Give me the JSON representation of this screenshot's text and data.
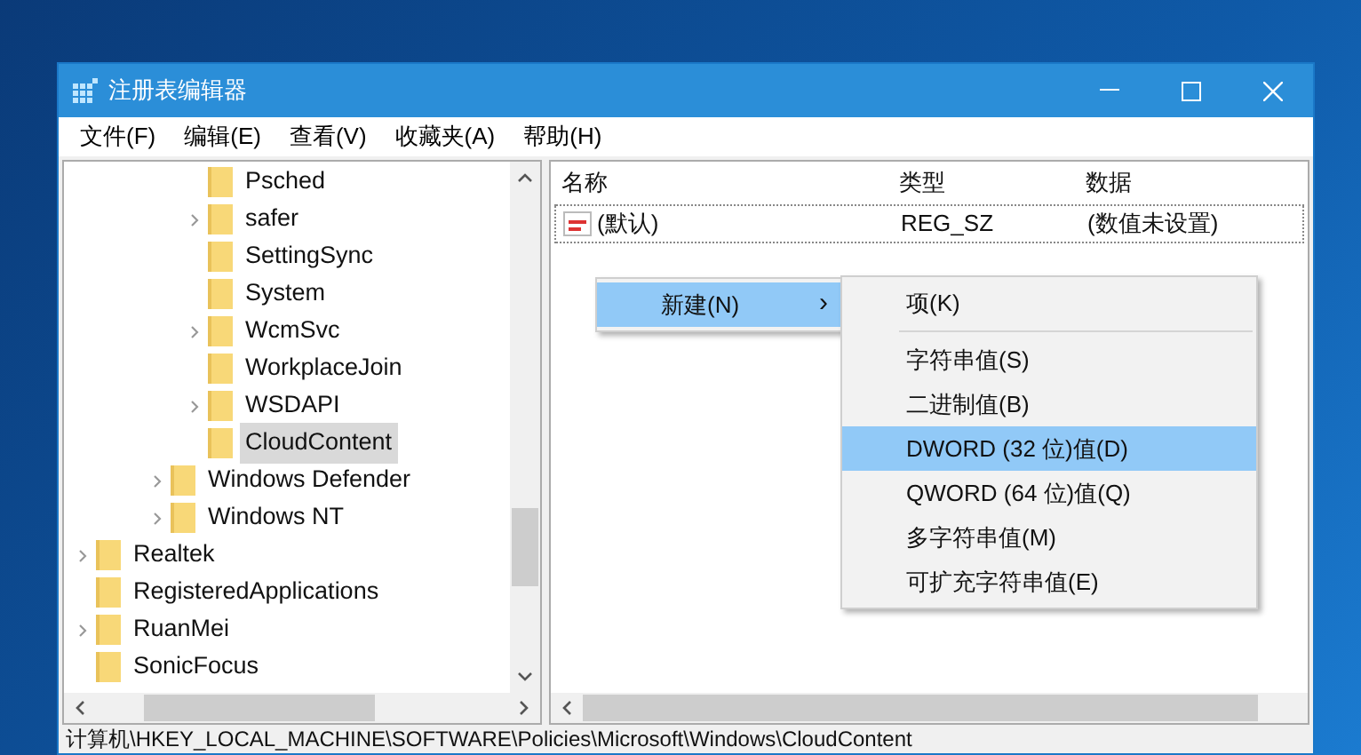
{
  "window": {
    "title": "注册表编辑器"
  },
  "menu_bar": [
    "文件(F)",
    "编辑(E)",
    "查看(V)",
    "收藏夹(A)",
    "帮助(H)"
  ],
  "tree": [
    {
      "children": [
        {
          "children": [
            {
              "children": [
                {
                  "label": "Psched",
                  "expandable": false,
                  "selected": false
                },
                {
                  "label": "safer",
                  "expandable": true,
                  "selected": false
                },
                {
                  "label": "SettingSync",
                  "expandable": false,
                  "selected": false
                },
                {
                  "label": "System",
                  "expandable": false,
                  "selected": false
                },
                {
                  "label": "WcmSvc",
                  "expandable": true,
                  "selected": false
                },
                {
                  "label": "WorkplaceJoin",
                  "expandable": false,
                  "selected": false
                },
                {
                  "label": "WSDAPI",
                  "expandable": true,
                  "selected": false
                },
                {
                  "label": "CloudContent",
                  "expandable": false,
                  "selected": true
                }
              ]
            },
            {
              "label": "Windows Defender",
              "expandable": true,
              "selected": false
            },
            {
              "label": "Windows NT",
              "expandable": true,
              "selected": false
            }
          ]
        }
      ]
    },
    {
      "label": "Realtek",
      "expandable": true,
      "selected": false
    },
    {
      "label": "RegisteredApplications",
      "expandable": false,
      "selected": false
    },
    {
      "label": "RuanMei",
      "expandable": true,
      "selected": false
    },
    {
      "label": "SonicFocus",
      "expandable": false,
      "selected": false
    }
  ],
  "values_list": {
    "columns": [
      "名称",
      "类型",
      "数据"
    ],
    "rows": [
      {
        "name": "(默认)",
        "type": "REG_SZ",
        "data": "(数值未设置)"
      }
    ]
  },
  "context_menu": {
    "items": [
      {
        "label": "新建(N)",
        "arrow": "›",
        "selected": true
      }
    ]
  },
  "submenu": {
    "items": [
      {
        "kind": "item",
        "label": "项(K)",
        "selected": false
      },
      {
        "kind": "separator"
      },
      {
        "kind": "item",
        "label": "字符串值(S)",
        "selected": false
      },
      {
        "kind": "item",
        "label": "二进制值(B)",
        "selected": false
      },
      {
        "kind": "item",
        "label": "DWORD (32 位)值(D)",
        "selected": true
      },
      {
        "kind": "item",
        "label": "QWORD (64 位)值(Q)",
        "selected": false
      },
      {
        "kind": "item",
        "label": "多字符串值(M)",
        "selected": false
      },
      {
        "kind": "item",
        "label": "可扩充字符串值(E)",
        "selected": false
      }
    ]
  },
  "status_bar": "计算机\\HKEY_LOCAL_MACHINE\\SOFTWARE\\Policies\\Microsoft\\Windows\\CloudContent"
}
